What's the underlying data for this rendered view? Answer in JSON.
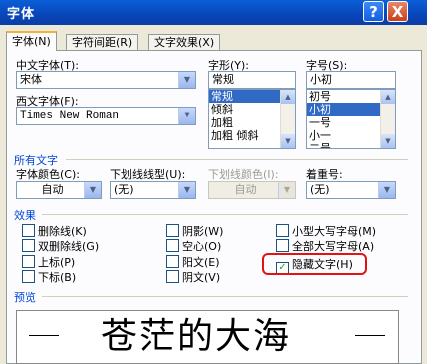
{
  "window": {
    "title": "字体",
    "help_label": "?",
    "close_label": "X"
  },
  "tabs": [
    {
      "label": "字体(N)"
    },
    {
      "label": "字符间距(R)"
    },
    {
      "label": "文字效果(X)"
    }
  ],
  "font": {
    "chinese_label": "中文字体(T):",
    "chinese_value": "宋体",
    "western_label": "西文字体(F):",
    "western_value": "Times New Roman",
    "style_label": "字形(Y):",
    "style_value": "常规",
    "style_options": [
      "常规",
      "倾斜",
      "加粗",
      "加粗 倾斜"
    ],
    "size_label": "字号(S):",
    "size_value": "小初",
    "size_options": [
      "初号",
      "小初",
      "一号",
      "小一",
      "二号"
    ]
  },
  "all_text": {
    "section_label": "所有文字",
    "color_label": "字体颜色(C):",
    "color_value": "自动",
    "underline_label": "下划线线型(U):",
    "underline_value": "(无)",
    "underline_color_label": "下划线颜色(I):",
    "underline_color_value": "自动",
    "emphasis_label": "着重号:",
    "emphasis_value": "(无)"
  },
  "effects": {
    "section_label": "效果",
    "col1": [
      "删除线(K)",
      "双删除线(G)",
      "上标(P)",
      "下标(B)"
    ],
    "col2": [
      "阴影(W)",
      "空心(O)",
      "阳文(E)",
      "阴文(V)"
    ],
    "col3": [
      "小型大写字母(M)",
      "全部大写字母(A)",
      "隐藏文字(H)"
    ],
    "checked_label": "✓"
  },
  "preview": {
    "label": "预览",
    "sample": "苍茫的大海"
  }
}
